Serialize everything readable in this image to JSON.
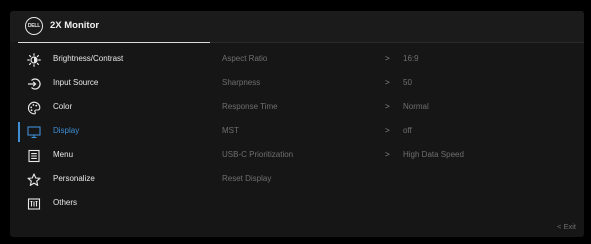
{
  "header": {
    "logo_text": "DELL",
    "title": "2X Monitor"
  },
  "menu": {
    "items": [
      {
        "label": "Brightness/Contrast",
        "icon": "brightness-icon"
      },
      {
        "label": "Input Source",
        "icon": "input-source-icon"
      },
      {
        "label": "Color",
        "icon": "color-palette-icon"
      },
      {
        "label": "Display",
        "icon": "display-icon",
        "active": true
      },
      {
        "label": "Menu",
        "icon": "menu-icon"
      },
      {
        "label": "Personalize",
        "icon": "star-icon"
      },
      {
        "label": "Others",
        "icon": "others-icon"
      }
    ]
  },
  "display_settings": {
    "rows": [
      {
        "name": "Aspect Ratio",
        "chevron": ">",
        "value": "16:9"
      },
      {
        "name": "Sharpness",
        "chevron": ">",
        "value": "50"
      },
      {
        "name": "Response Time",
        "chevron": ">",
        "value": "Normal"
      },
      {
        "name": "MST",
        "chevron": ">",
        "value": "off"
      },
      {
        "name": "USB-C Prioritization",
        "chevron": ">",
        "value": "High Data Speed"
      },
      {
        "name": "Reset Display"
      }
    ]
  },
  "footer": {
    "exit_label": "< Exit"
  },
  "colors": {
    "accent": "#3e8fd6",
    "panel": "#161616",
    "text": "#e8e8e8",
    "dim_text": "#6f6f6f"
  }
}
